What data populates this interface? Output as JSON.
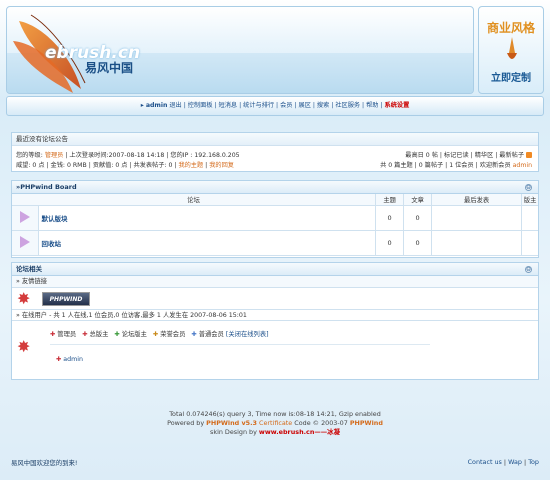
{
  "header": {
    "logo_en": "ebrush.cn",
    "logo_cn": "易风中国",
    "promo_line1": "商业风格",
    "promo_line2": "立即定制"
  },
  "nav": {
    "user": "admin",
    "logout": "退出",
    "items": [
      "控制面板",
      "短消息",
      "统计与排行",
      "会员",
      "展区",
      "搜索",
      "社区服务",
      "帮助"
    ],
    "highlight": "系统设置"
  },
  "notice": {
    "title": "最近没有论坛公告",
    "row1_left_prefix": "您的等级:",
    "level": "管理员",
    "row1_left_rest": "| 上次登录时间:2007-08-18 14:18 | 您的IP : 192.168.0.205",
    "row1_right": "最高日 0 帖 | 标记已读 | 精华区 | 最新帖子",
    "row2_left_prefix": "威望: 0 点 | 金钱: 0 RMB | 贡献值: 0 点 | 共发表帖子: 0 |",
    "my_topics": "我的主题",
    "my_replies": "我的回复",
    "row2_right_prefix": "共 0 篇主题 | 0 篇帖子 | 1 位会员 | 欢迎新会员",
    "new_member": "admin"
  },
  "board": {
    "title": "PHPwind Board",
    "toggle": "⊖",
    "columns": [
      "论坛",
      "主题",
      "文章",
      "最后发表",
      "版主"
    ],
    "rows": [
      {
        "name": "默认版块",
        "topics": "0",
        "posts": "0",
        "last": "",
        "mod": ""
      },
      {
        "name": "回收站",
        "topics": "0",
        "posts": "0",
        "last": "",
        "mod": ""
      }
    ]
  },
  "forum_related": {
    "title": "论坛相关",
    "toggle": "⊖",
    "links_title": "友情链接",
    "partner_logo": "PHPWIND",
    "online_line": "在线用户 - 共 1 人在线,1 位会员,0 位访客,最多 1 人发生在 2007-08-06 15:01",
    "legend": [
      "管理员",
      "总版主",
      "论坛版主",
      "荣誉会员",
      "普通会员"
    ],
    "close_list": "[关闭在线列表]",
    "online_user": "admin"
  },
  "footer": {
    "line1": "Total 0.074246(s) query 3, Time now is:08-18 14:21, Gzip enabled",
    "line2_prefix": "Powered by",
    "product": "PHPWind v5.3",
    "certificate": "Certificate",
    "line2_mid": "Code © 2003-07",
    "product2": "PHPWind",
    "line3_prefix": "skin Design by",
    "designer": "www.ebrush.cn——冰凝",
    "welcome": "易风中国欢迎您的到来!",
    "links": [
      "Contact us",
      "Wap",
      "Top"
    ]
  },
  "colors": {
    "accent": "#1b4f8a",
    "highlight_red": "#cc0000",
    "orange": "#d46a1a",
    "header_bg": "#d9ecf8"
  }
}
